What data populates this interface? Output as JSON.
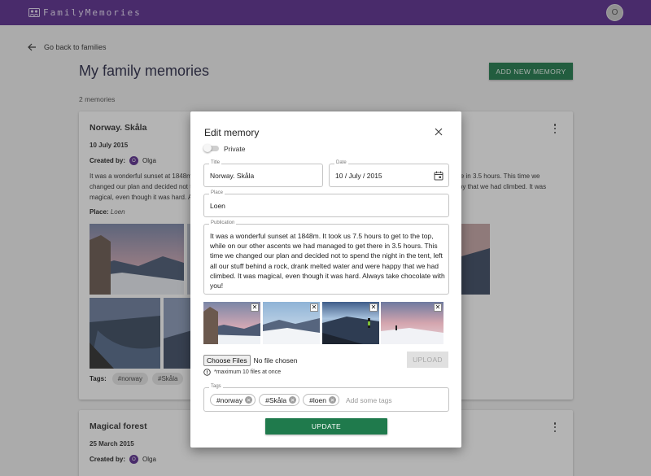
{
  "app": {
    "brand": "FamilyMemories",
    "avatar_initial": "O"
  },
  "page": {
    "back_label": "Go back to families",
    "title": "My family memories",
    "add_label": "ADD NEW MEMORY",
    "count_label": "2 memories"
  },
  "cards": [
    {
      "title": "Norway. Skåla",
      "date": "10 July 2015",
      "created_by_label": "Created by:",
      "author_initial": "O",
      "author": "Olga",
      "text_left": "It was a wonderful sunset at 1848m. It took us 7.5 hours to get to the top, while on our other ascents we had managed to get there in 3.5 hours. This time we changed our plan and decided not to spend the night in the tent, left all our stuff behind a rock, drank melted water and were happy that we had climbed. It was magical, even though it was hard. Always take chocolate with you!",
      "place_label": "Place:",
      "place": "Loen",
      "tags_label": "Tags:",
      "tags": [
        "#norway",
        "#Skåla"
      ]
    },
    {
      "title": "Magical forest",
      "date": "25 March 2015",
      "created_by_label": "Created by:",
      "author_initial": "O",
      "author": "Olga"
    }
  ],
  "dialog": {
    "title": "Edit memory",
    "private_label": "Private",
    "title_field": {
      "label": "Title",
      "value": "Norway. Skåla"
    },
    "date_field": {
      "label": "Date",
      "value": "10 / July / 2015"
    },
    "place_field": {
      "label": "Place",
      "value": "Loen"
    },
    "publication_field": {
      "label": "Publication",
      "value": "It was a wonderful sunset at 1848m. It took us 7.5 hours to get to the top, while on our other ascents we had managed to get there in 3.5 hours. This time we changed our plan and decided not to spend the night in the tent, left all our stuff behind a rock, drank melted water and were happy that we had climbed. It was magical, even though it was hard. Always take chocolate with you!"
    },
    "remove_symbol": "✕",
    "choose_files_label": "Choose Files",
    "no_file_label": "No file chosen",
    "upload_label": "UPLOAD",
    "max_note": "*maximum 10 files at once",
    "tags_field": {
      "label": "Tags",
      "chips": [
        "#norway",
        "#Skåla",
        "#loen"
      ],
      "placeholder": "Add some tags"
    },
    "update_label": "UPDATE"
  },
  "colors": {
    "topbar": "#5b2d90",
    "primary_green": "#1f7a4c",
    "disabled": "#e0e0e0"
  }
}
